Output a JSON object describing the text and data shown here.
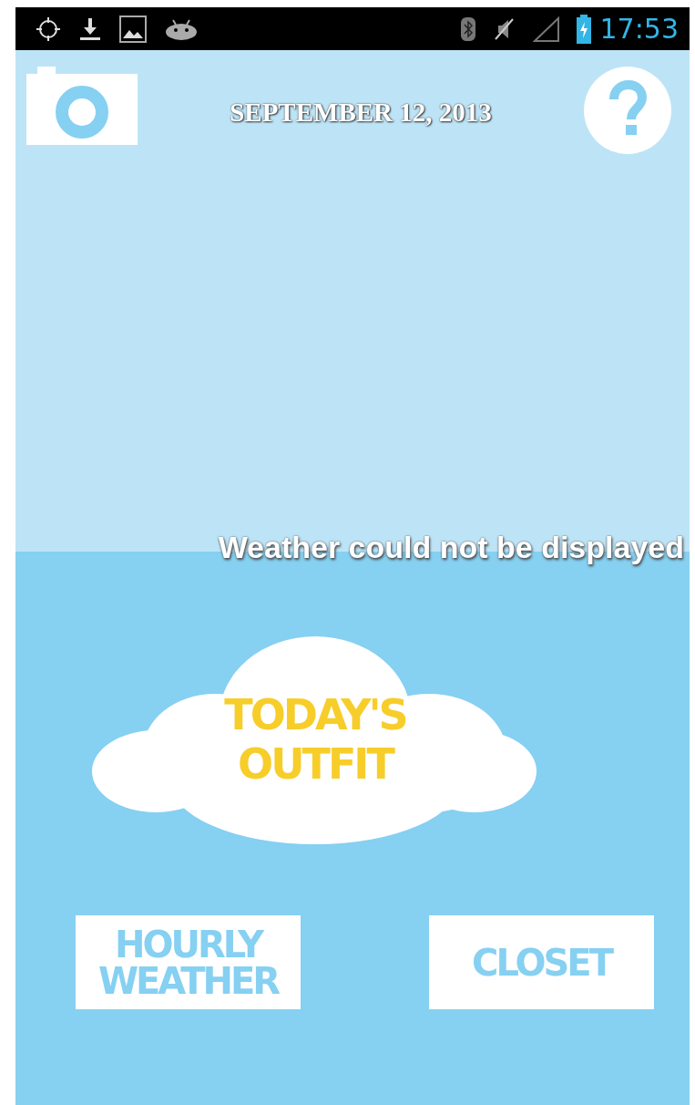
{
  "status_bar": {
    "time": "17:53"
  },
  "header": {
    "date": "SEPTEMBER 12, 2013"
  },
  "weather": {
    "message": "Weather could not be displayed"
  },
  "main_button": {
    "label": "TODAY'S OUTFIT"
  },
  "buttons": [
    {
      "label": "HOURLY WEATHER"
    },
    {
      "label": "CLOSET"
    }
  ]
}
